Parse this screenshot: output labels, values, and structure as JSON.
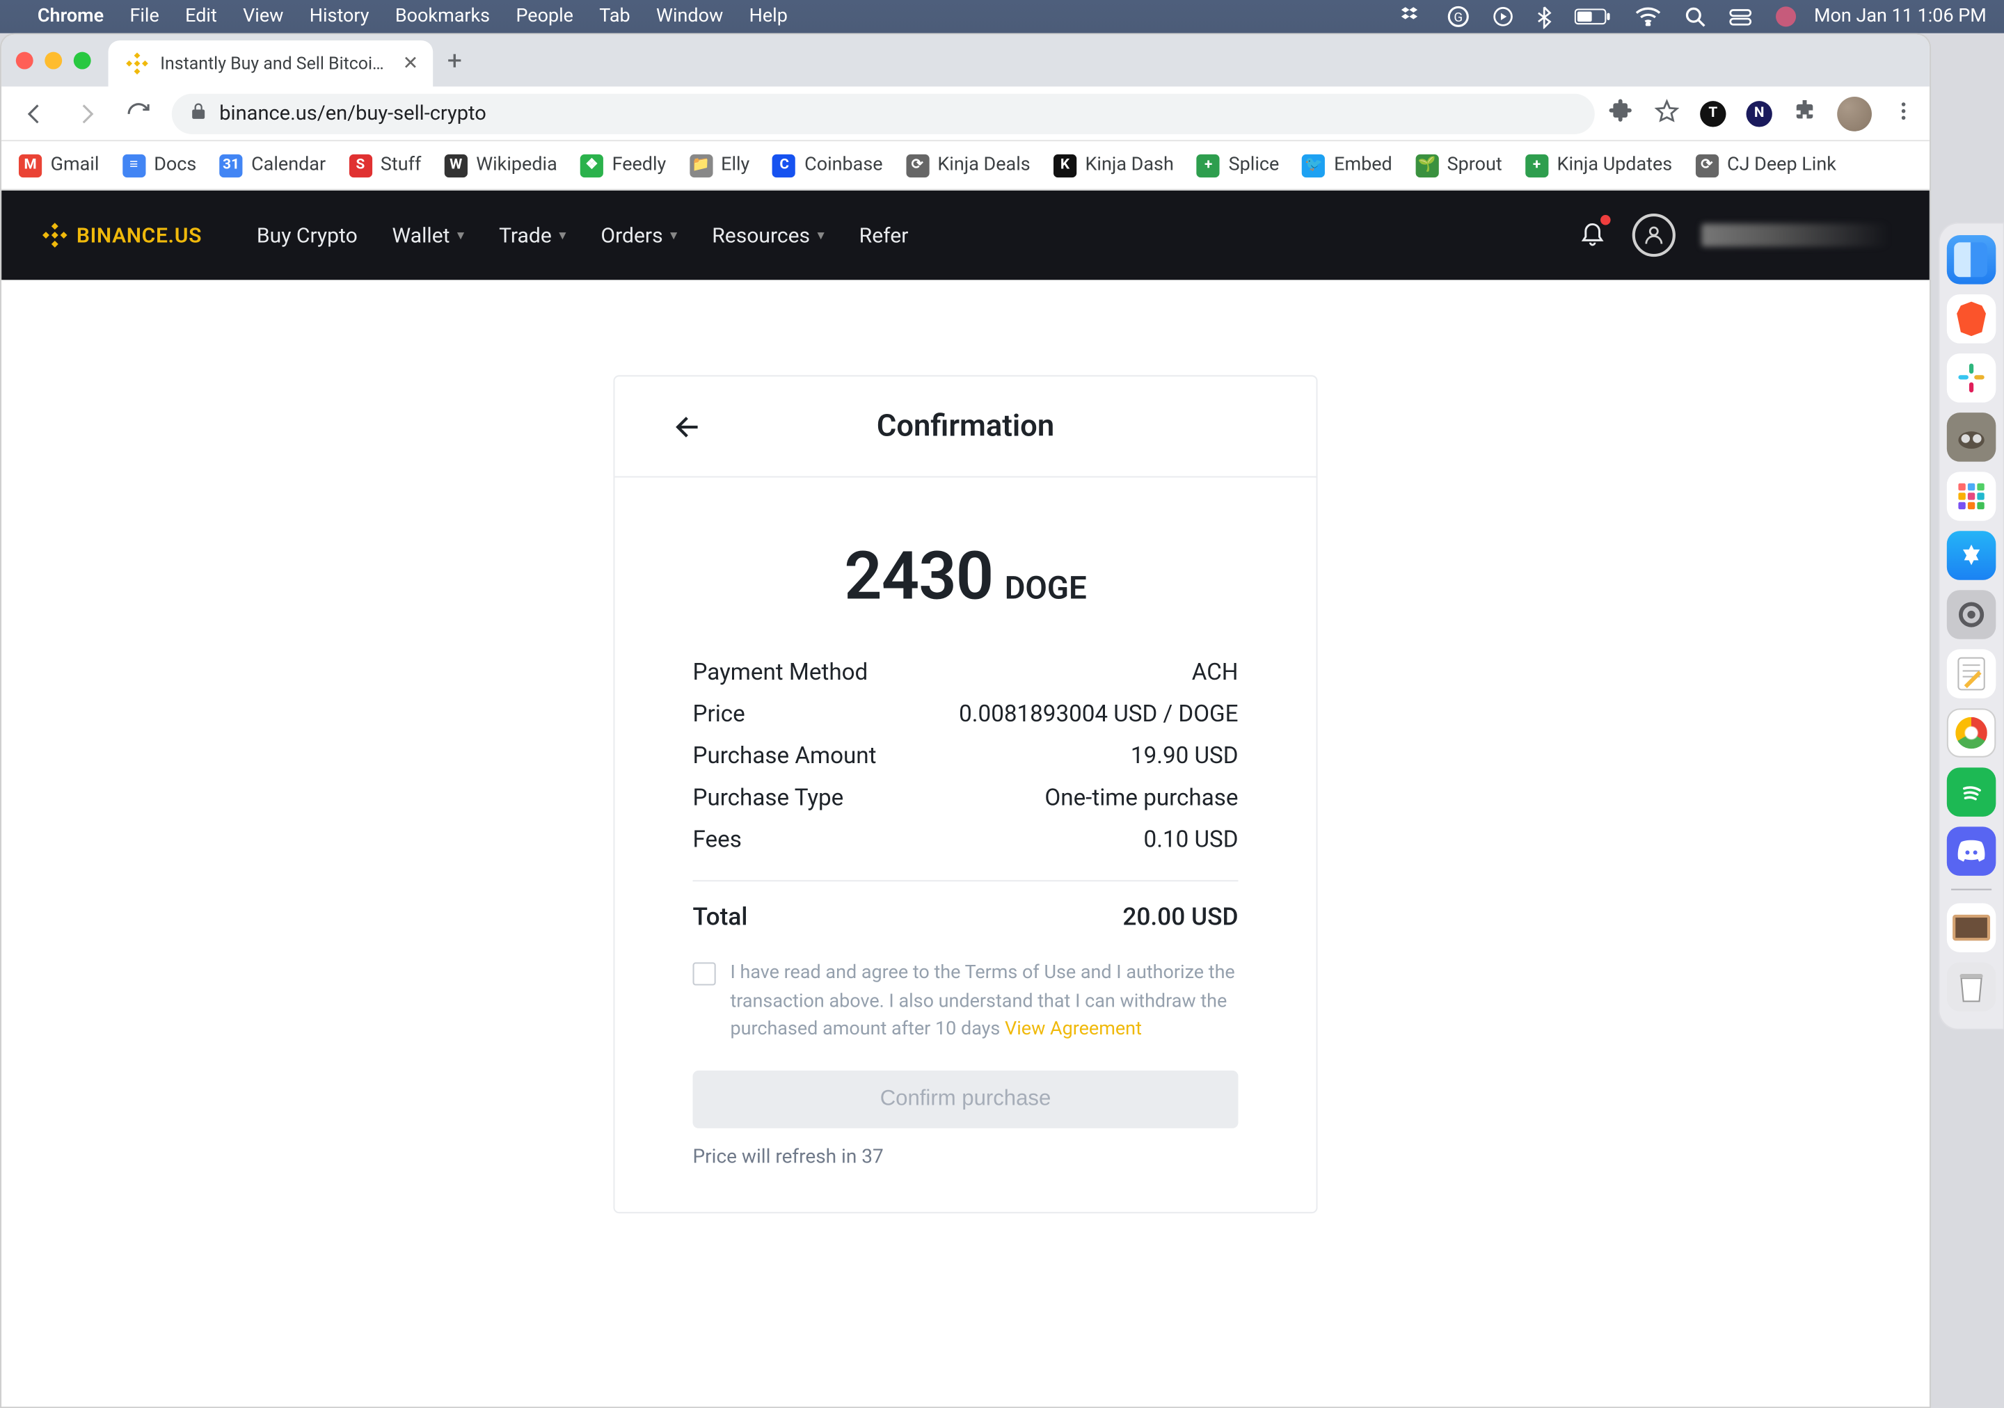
{
  "mac_menu": {
    "app": "Chrome",
    "items": [
      "File",
      "Edit",
      "View",
      "History",
      "Bookmarks",
      "People",
      "Tab",
      "Window",
      "Help"
    ],
    "clock": "Mon Jan 11  1:06 PM"
  },
  "browser": {
    "tab_title": "Instantly Buy and Sell Bitcoin, E",
    "url": "binance.us/en/buy-sell-crypto",
    "badge_letters": [
      "T",
      "N"
    ]
  },
  "bookmarks": [
    {
      "label": "Gmail",
      "color": "#ea4335",
      "glyph": "M"
    },
    {
      "label": "Docs",
      "color": "#4285f4",
      "glyph": "≡"
    },
    {
      "label": "Calendar",
      "color": "#4285f4",
      "glyph": "31"
    },
    {
      "label": "Stuff",
      "color": "#e03131",
      "glyph": "S"
    },
    {
      "label": "Wikipedia",
      "color": "#333",
      "glyph": "W"
    },
    {
      "label": "Feedly",
      "color": "#2bb24c",
      "glyph": "❖"
    },
    {
      "label": "Elly",
      "color": "#888",
      "glyph": "📁"
    },
    {
      "label": "Coinbase",
      "color": "#1652f0",
      "glyph": "C"
    },
    {
      "label": "Kinja Deals",
      "color": "#666",
      "glyph": "⟳"
    },
    {
      "label": "Kinja Dash",
      "color": "#111",
      "glyph": "K"
    },
    {
      "label": "Splice",
      "color": "#2e9e4e",
      "glyph": "+"
    },
    {
      "label": "Embed",
      "color": "#1da1f2",
      "glyph": "🐦"
    },
    {
      "label": "Sprout",
      "color": "#3a913f",
      "glyph": "🌱"
    },
    {
      "label": "Kinja Updates",
      "color": "#2e9e4e",
      "glyph": "+"
    },
    {
      "label": "CJ Deep Link",
      "color": "#666",
      "glyph": "⟳"
    }
  ],
  "topnav": {
    "brand": "BINANCE.US",
    "links": [
      {
        "label": "Buy Crypto",
        "caret": false
      },
      {
        "label": "Wallet",
        "caret": true
      },
      {
        "label": "Trade",
        "caret": true
      },
      {
        "label": "Orders",
        "caret": true
      },
      {
        "label": "Resources",
        "caret": true
      },
      {
        "label": "Refer",
        "caret": false
      }
    ]
  },
  "card": {
    "title": "Confirmation",
    "amount": "2430",
    "symbol": "DOGE",
    "rows": [
      {
        "k": "Payment Method",
        "v": "ACH"
      },
      {
        "k": "Price",
        "v": "0.0081893004 USD / DOGE"
      },
      {
        "k": "Purchase Amount",
        "v": "19.90 USD"
      },
      {
        "k": "Purchase Type",
        "v": "One-time purchase"
      },
      {
        "k": "Fees",
        "v": "0.10 USD"
      }
    ],
    "total_k": "Total",
    "total_v": "20.00 USD",
    "agree_text": "I have read and agree to the Terms of Use and I authorize the transaction above. I also understand that I can withdraw the purchased amount after 10 days ",
    "agree_link": "View Agreement",
    "confirm_label": "Confirm purchase",
    "refresh_prefix": "Price will refresh in ",
    "refresh_seconds": "37"
  }
}
